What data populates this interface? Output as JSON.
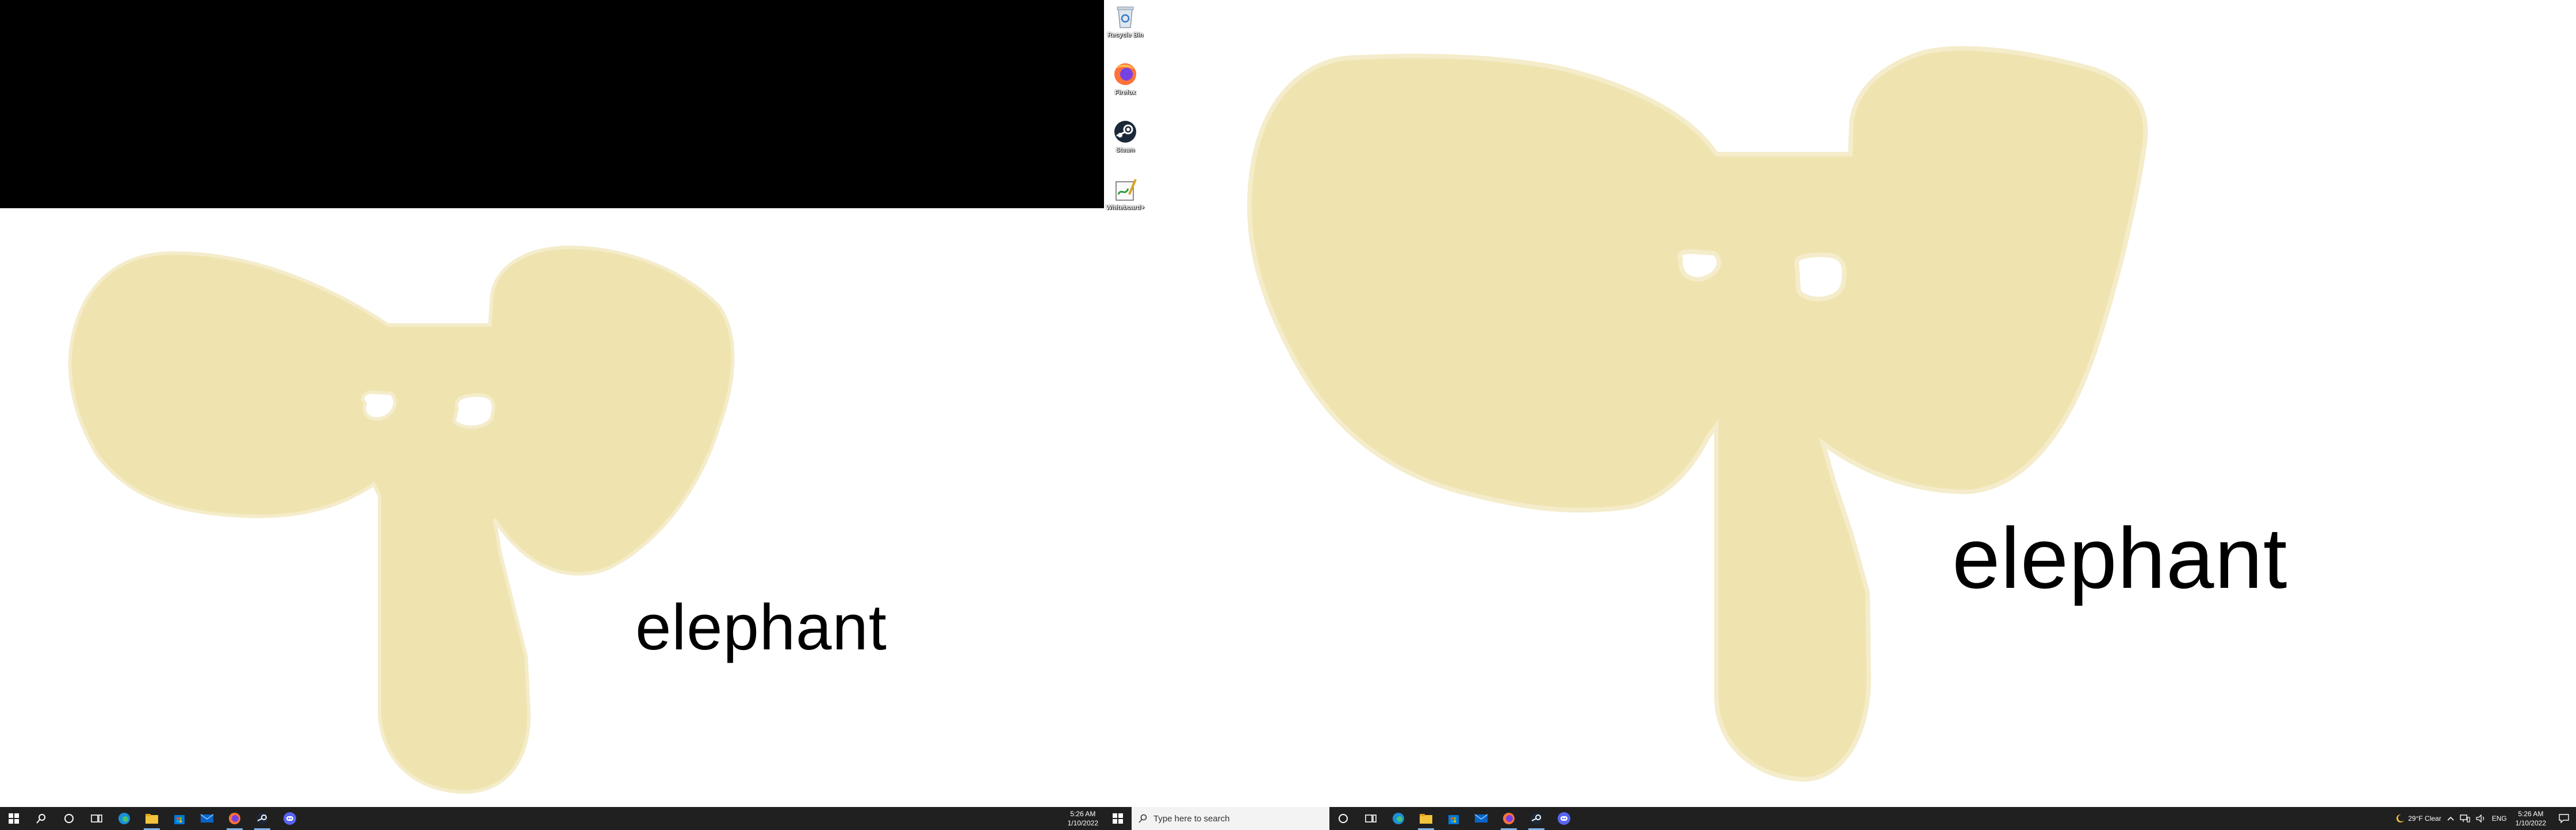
{
  "desktop": {
    "icons": [
      {
        "label": "Recycle Bin",
        "icon": "recycle-bin-icon"
      },
      {
        "label": "Firefox",
        "icon": "firefox-icon"
      },
      {
        "label": "Steam",
        "icon": "steam-icon"
      },
      {
        "label": "Whiteboard+",
        "icon": "whiteboard-icon"
      }
    ]
  },
  "drawing": {
    "word": "elephant",
    "fill_color": "#efe4b0"
  },
  "left_taskbar": {
    "clock_time": "5:26 AM",
    "clock_date": "1/10/2022"
  },
  "right_taskbar": {
    "search_placeholder": "Type here to search",
    "weather": "29°F Clear",
    "lang": "ENG",
    "clock_time": "5:26 AM",
    "clock_date": "1/10/2022"
  },
  "colors": {
    "taskbar": "#202020",
    "accent_underline": "#7fb3e6"
  }
}
